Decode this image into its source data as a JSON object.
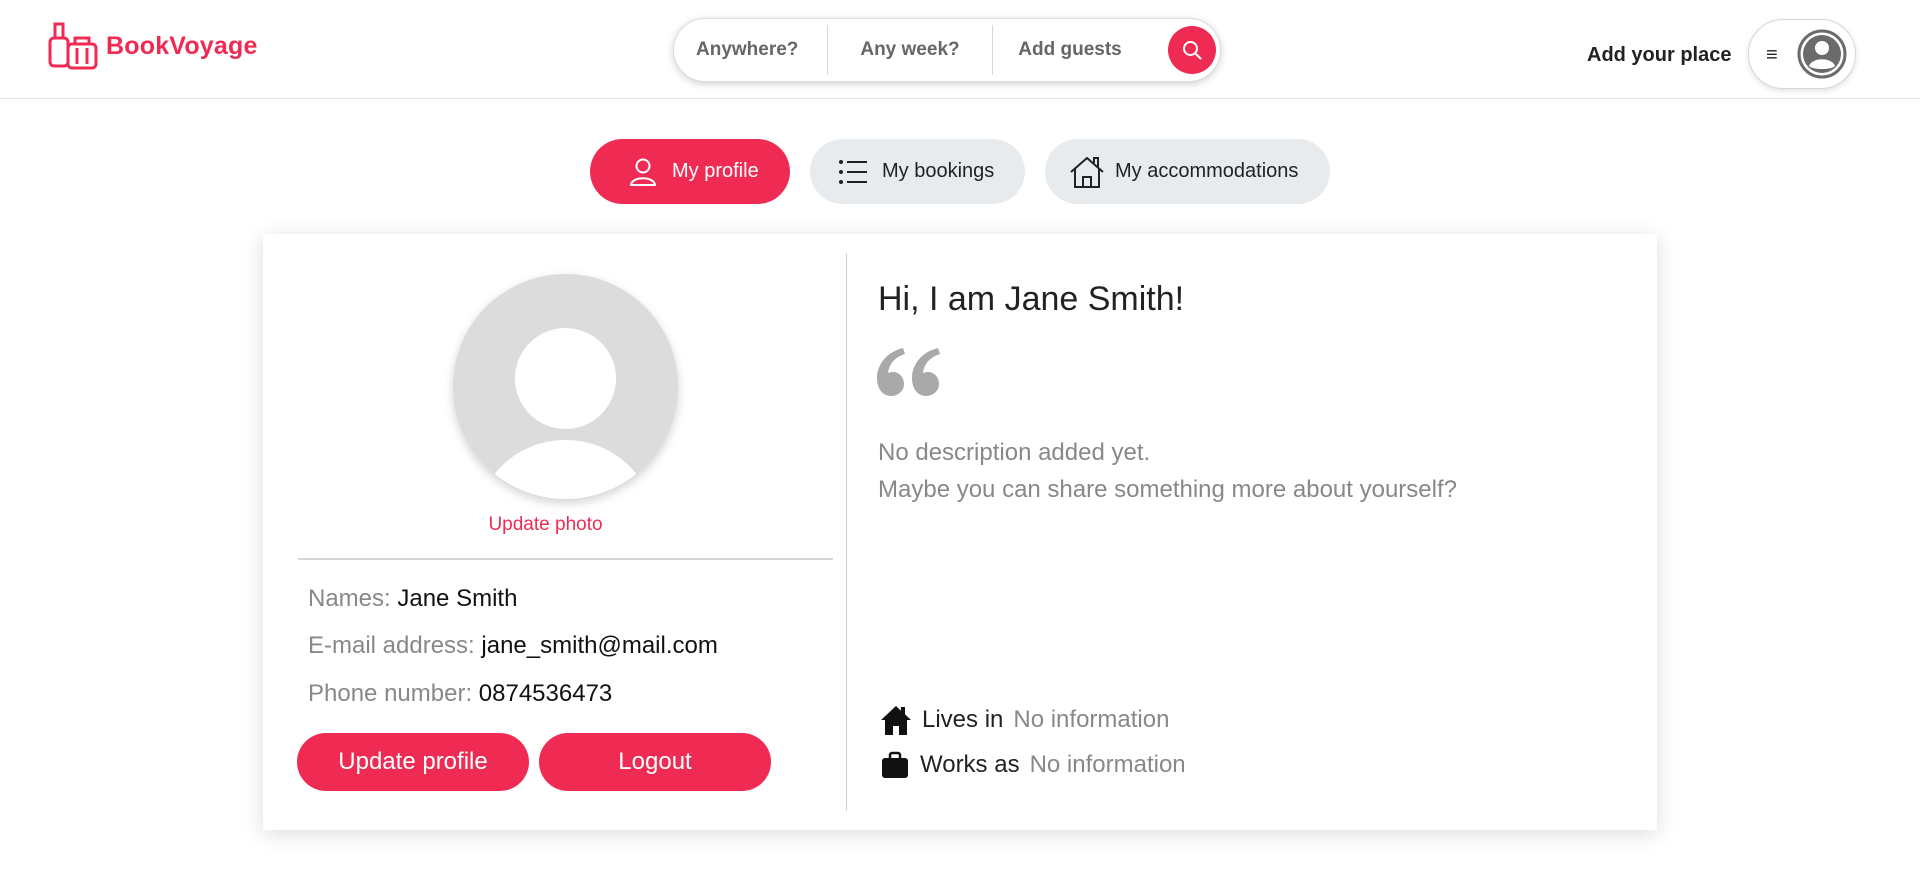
{
  "brand": {
    "name": "BookVoyage",
    "color": "#ef2b54"
  },
  "search": {
    "where": "Anywhere?",
    "week": "Any week?",
    "guests": "Add guests",
    "button_icon": "search-icon"
  },
  "header": {
    "add_place": "Add your place",
    "menu_icon": "hamburger-menu-icon",
    "avatar_icon": "user-avatar-icon"
  },
  "tabs": [
    {
      "label": "My profile",
      "icon": "user-icon",
      "active": true
    },
    {
      "label": "My bookings",
      "icon": "list-icon",
      "active": false
    },
    {
      "label": "My accommodations",
      "icon": "house-icon",
      "active": false
    }
  ],
  "profile": {
    "update_photo": "Update photo",
    "names_label": "Names:",
    "names_value": "Jane Smith",
    "email_label": "E-mail address:",
    "email_value": "jane_smith@mail.com",
    "phone_label": "Phone number:",
    "phone_value": "0874536473",
    "update_button": "Update profile",
    "logout_button": "Logout"
  },
  "about": {
    "greeting": "Hi, I am Jane Smith!",
    "desc_line1": "No description added yet.",
    "desc_line2": "Maybe you can share something more about yourself?",
    "lives_label": "Lives in",
    "lives_value": "No information",
    "works_label": "Works as",
    "works_value": "No information"
  }
}
